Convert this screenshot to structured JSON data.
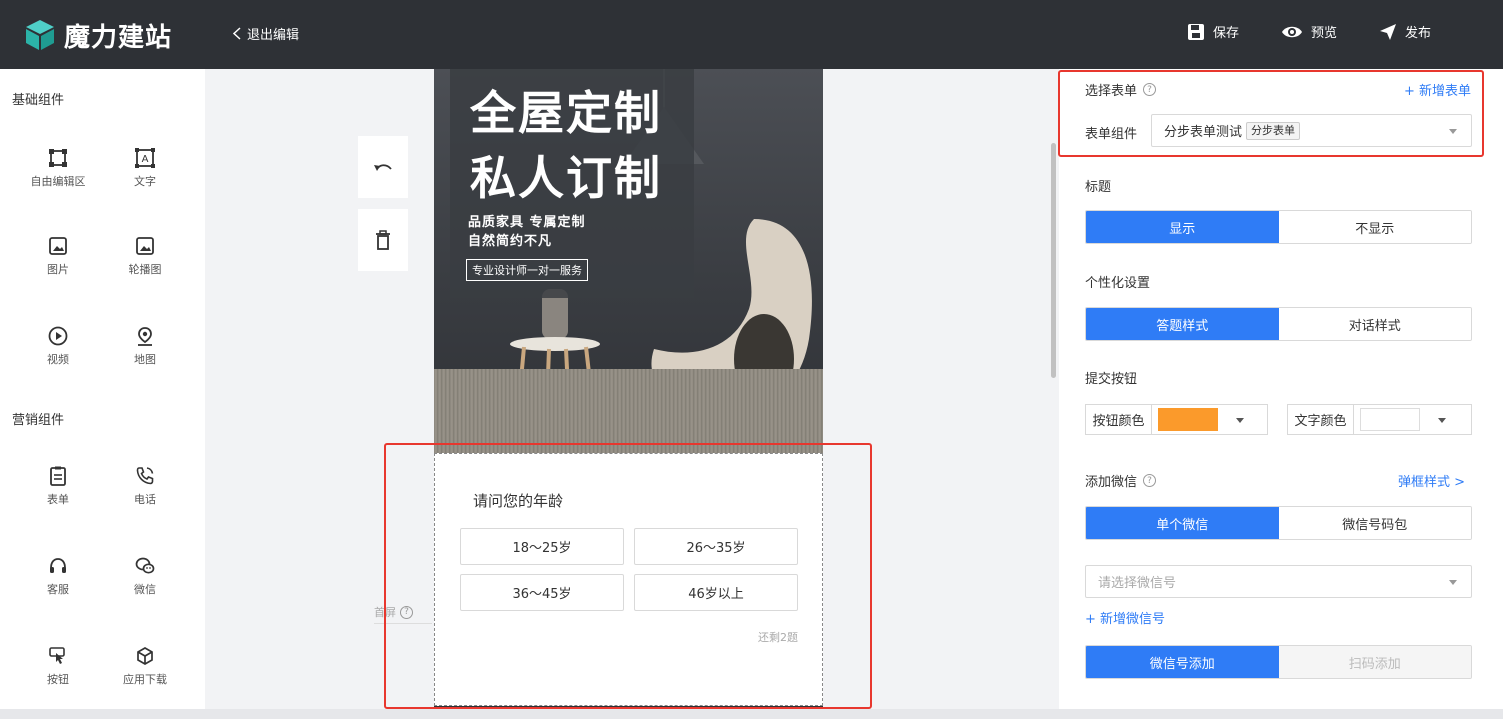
{
  "app": {
    "logo_text": "魔力建站",
    "exit_label": "退出编辑"
  },
  "header": {
    "save_label": "保存",
    "preview_label": "预览",
    "publish_label": "发布"
  },
  "sidebar": {
    "basic_title": "基础组件",
    "basic_items": [
      "自由编辑区",
      "文字",
      "图片",
      "轮播图",
      "视频",
      "地图"
    ],
    "marketing_title": "营销组件",
    "marketing_items": [
      "表单",
      "电话",
      "客服",
      "微信",
      "按钮",
      "应用下载"
    ]
  },
  "canvas": {
    "hero_title_1": "全屋定制",
    "hero_title_2": "私人订制",
    "hero_sub_1": "品质家具  专属定制",
    "hero_sub_2": "自然简约不凡",
    "hero_tag": "专业设计师一对一服务",
    "question": "请问您的年龄",
    "options": [
      "18～25岁",
      "26～35岁",
      "36～45岁",
      "46岁以上"
    ],
    "remaining": "还剩2题",
    "first_screen_label": "首屏"
  },
  "panel": {
    "select_form": {
      "title": "选择表单",
      "add_link": "+ 新增表单",
      "field_label": "表单组件",
      "value": "分步表单测试",
      "badge": "分步表单"
    },
    "title_section": {
      "label": "标题",
      "options": [
        "显示",
        "不显示"
      ],
      "selected": "显示"
    },
    "personalize": {
      "label": "个性化设置",
      "options": [
        "答题样式",
        "对话样式"
      ],
      "selected": "答题样式"
    },
    "submit": {
      "label": "提交按钮",
      "button_color_label": "按钮颜色",
      "button_color": "#fb9a2b",
      "text_color_label": "文字颜色",
      "text_color": "#ffffff"
    },
    "wechat": {
      "label": "添加微信",
      "popup_link": "弹框样式 >",
      "options": [
        "单个微信",
        "微信号码包"
      ],
      "selected": "单个微信",
      "select_placeholder": "请选择微信号",
      "add_link": "+ 新增微信号",
      "add_options": [
        "微信号添加",
        "扫码添加"
      ]
    }
  },
  "colors": {
    "accent": "#2f7cf6",
    "topbar": "#2e3136",
    "highlight": "#e8372e"
  }
}
